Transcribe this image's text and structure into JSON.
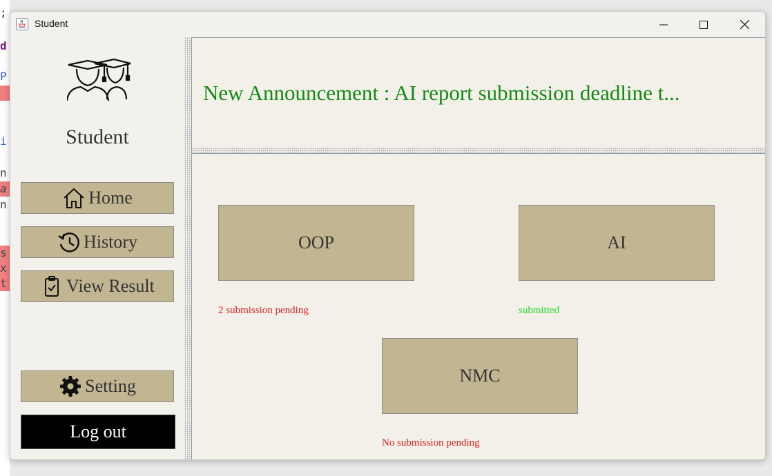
{
  "background_code": [
    ";",
    "d",
    "P",
    "",
    "",
    "i",
    "",
    "n",
    "a",
    "n",
    "",
    "",
    "s",
    "x",
    "t"
  ],
  "window": {
    "title": "Student",
    "controls": {
      "minimize": "—",
      "maximize": "☐",
      "close": "✕"
    }
  },
  "sidebar": {
    "title": "Student",
    "buttons": [
      {
        "label": "Home",
        "icon": "home-icon"
      },
      {
        "label": "History",
        "icon": "history-icon"
      },
      {
        "label": "View Result",
        "icon": "clipboard-check-icon"
      },
      {
        "label": "Setting",
        "icon": "gear-icon"
      }
    ],
    "logout_label": "Log out"
  },
  "announcement": {
    "text": "New Announcement : AI report submission deadline t..."
  },
  "courses": [
    {
      "name": "OOP",
      "status": "2 submission pending",
      "status_color": "#e02020"
    },
    {
      "name": "AI",
      "status": "submitted",
      "status_color": "#22dd22"
    },
    {
      "name": "NMC",
      "status": "No submission pending",
      "status_color": "#e02020"
    }
  ],
  "colors": {
    "button_bg": "#c2b592",
    "announcement": "#138a13",
    "logout_bg": "#000000"
  }
}
